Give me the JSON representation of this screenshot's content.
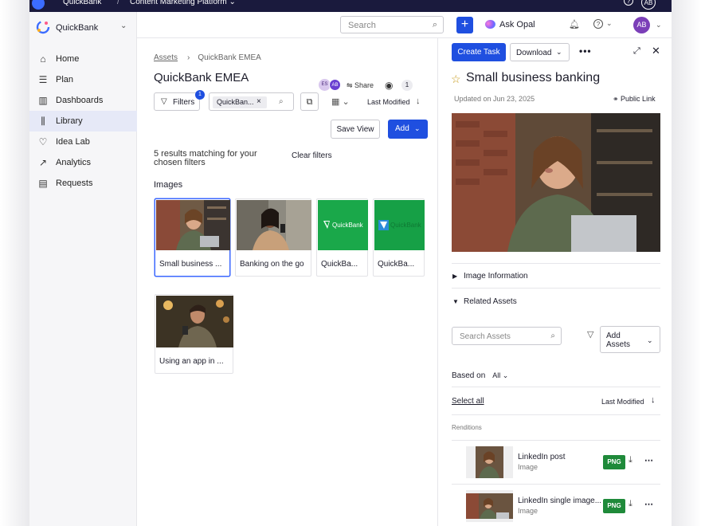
{
  "topbar": {
    "brand": "QuickBank",
    "separator": "/",
    "platform": "Content Marketing Platform ⌄",
    "avatar_initials": "AB"
  },
  "workspace": {
    "name": "QuickBank"
  },
  "nav": [
    {
      "label": "Home",
      "icon": "home-icon",
      "glyph": "⌂"
    },
    {
      "label": "Plan",
      "icon": "list-icon",
      "glyph": "☰"
    },
    {
      "label": "Dashboards",
      "icon": "bar-chart-icon",
      "glyph": "▥"
    },
    {
      "label": "Library",
      "icon": "library-icon",
      "glyph": "⫼"
    },
    {
      "label": "Idea Lab",
      "icon": "lightbulb-icon",
      "glyph": "♡"
    },
    {
      "label": "Analytics",
      "icon": "trend-icon",
      "glyph": "↗"
    },
    {
      "label": "Requests",
      "icon": "document-icon",
      "glyph": "▤"
    }
  ],
  "header": {
    "search_placeholder": "Search",
    "ask_opal": "Ask Opal",
    "user_initials": "AB"
  },
  "main": {
    "breadcrumb_root": "Assets",
    "breadcrumb_current": "QuickBank EMEA",
    "title": "QuickBank EMEA",
    "collaborator_1": "ES",
    "collaborator_2": "AB",
    "share": "Share",
    "view_count": "1",
    "filters_label": "Filters",
    "filters_count": "1",
    "chip_label": "QuickBan...",
    "sort_label": "Last Modified",
    "save_view": "Save View",
    "add": "Add",
    "results_text": "5 results matching for your chosen filters",
    "clear_filters": "Clear filters",
    "section_title": "Images",
    "cards": [
      {
        "caption": "Small business ..."
      },
      {
        "caption": "Banking on the go"
      },
      {
        "caption": "QuickBa..."
      },
      {
        "caption": "QuickBa..."
      },
      {
        "caption": "Using an app in ..."
      }
    ],
    "tile_logo_text": "QuickBank"
  },
  "panel": {
    "create_task": "Create Task",
    "download": "Download",
    "asset_title": "Small business banking",
    "updated": "Updated on Jun 23, 2025",
    "public_link": "Public Link",
    "image_information": "Image Information",
    "related_assets": "Related Assets",
    "search_assets_placeholder": "Search Assets",
    "add_assets": "Add Assets",
    "based_on_label": "Based on",
    "based_on_value": "All ⌄",
    "select_all": "Select all",
    "sort_label": "Last Modified",
    "renditions_label": "Renditions",
    "renditions": [
      {
        "name": "LinkedIn post",
        "type": "Image",
        "format": "PNG"
      },
      {
        "name": "LinkedIn single image...",
        "type": "Image",
        "format": "PNG"
      }
    ]
  },
  "colors": {
    "primary": "#1f4fe0",
    "topbar": "#1a1a3d",
    "png_badge": "#1f8a3a",
    "tile_green": "#1aa84a"
  }
}
